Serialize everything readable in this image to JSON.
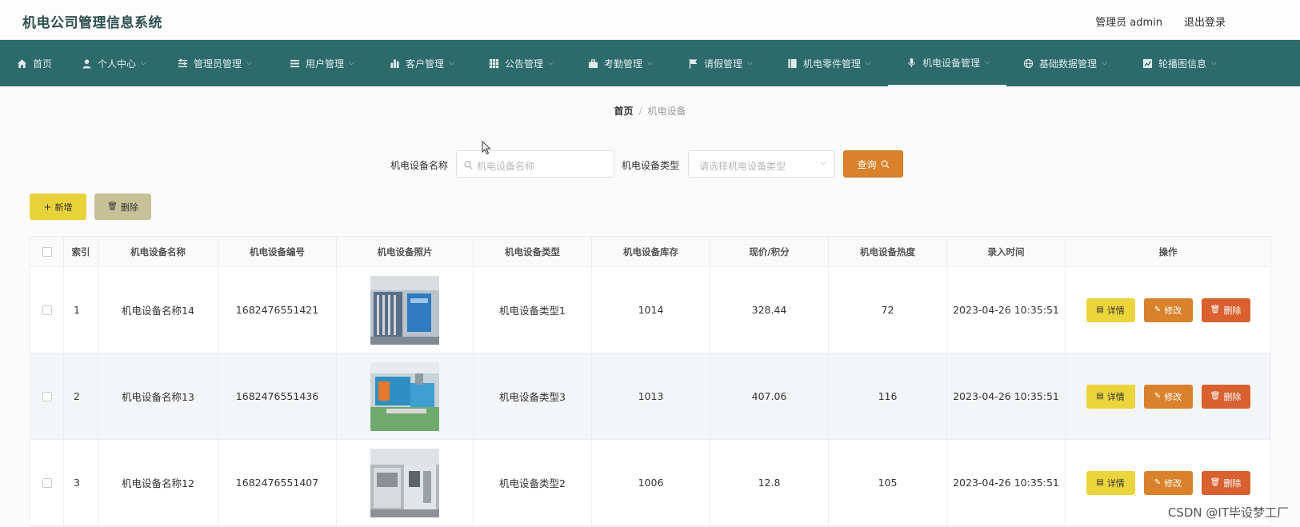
{
  "app": {
    "title": "机电公司管理信息系统",
    "user": "管理员 admin",
    "logout": "退出登录"
  },
  "nav": [
    {
      "label": "首页",
      "icon": "home-icon",
      "dropdown": false
    },
    {
      "label": "个人中心",
      "icon": "user-icon",
      "dropdown": true
    },
    {
      "label": "管理员管理",
      "icon": "sliders-icon",
      "dropdown": true
    },
    {
      "label": "用户管理",
      "icon": "list-icon",
      "dropdown": true
    },
    {
      "label": "客户管理",
      "icon": "bar-chart-icon",
      "dropdown": true
    },
    {
      "label": "公告管理",
      "icon": "grid-icon",
      "dropdown": true
    },
    {
      "label": "考勤管理",
      "icon": "briefcase-icon",
      "dropdown": true
    },
    {
      "label": "请假管理",
      "icon": "flag-icon",
      "dropdown": true
    },
    {
      "label": "机电零件管理",
      "icon": "book-icon",
      "dropdown": true
    },
    {
      "label": "机电设备管理",
      "icon": "microphone-icon",
      "dropdown": true,
      "active": true
    },
    {
      "label": "基础数据管理",
      "icon": "globe-icon",
      "dropdown": true
    },
    {
      "label": "轮播图信息",
      "icon": "chart-line-icon",
      "dropdown": true
    }
  ],
  "breadcrumb": {
    "home": "首页",
    "sep": "/",
    "current": "机电设备"
  },
  "search": {
    "name_label": "机电设备名称",
    "name_placeholder": "机电设备名称",
    "type_label": "机电设备类型",
    "type_placeholder": "请选择机电设备类型",
    "query_label": "查询"
  },
  "actions": {
    "add_label": "新增",
    "delete_label": "删除"
  },
  "table": {
    "headers": [
      "索引",
      "机电设备名称",
      "机电设备编号",
      "机电设备照片",
      "机电设备类型",
      "机电设备库存",
      "现价/积分",
      "机电设备热度",
      "录入时间",
      "操作"
    ],
    "rows": [
      {
        "index": "1",
        "name": "机电设备名称14",
        "code": "1682476551421",
        "type": "机电设备类型1",
        "stock": "1014",
        "price": "328.44",
        "heat": "72",
        "time": "2023-04-26 10:35:51"
      },
      {
        "index": "2",
        "name": "机电设备名称13",
        "code": "1682476551436",
        "type": "机电设备类型3",
        "stock": "1013",
        "price": "407.06",
        "heat": "116",
        "time": "2023-04-26 10:35:51"
      },
      {
        "index": "3",
        "name": "机电设备名称12",
        "code": "1682476551407",
        "type": "机电设备类型2",
        "stock": "1006",
        "price": "12.8",
        "heat": "105",
        "time": "2023-04-26 10:35:51"
      }
    ],
    "op_labels": {
      "detail": "详情",
      "edit": "修改",
      "delete": "删除"
    }
  },
  "watermark": "CSDN @IT毕设梦工厂",
  "colors": {
    "nav_bg": "#2d6a6c",
    "query": "#d9822b",
    "add": "#e8d23a",
    "detail": "#ecd43c",
    "edit": "#d9822b",
    "delete": "#d9602f"
  }
}
